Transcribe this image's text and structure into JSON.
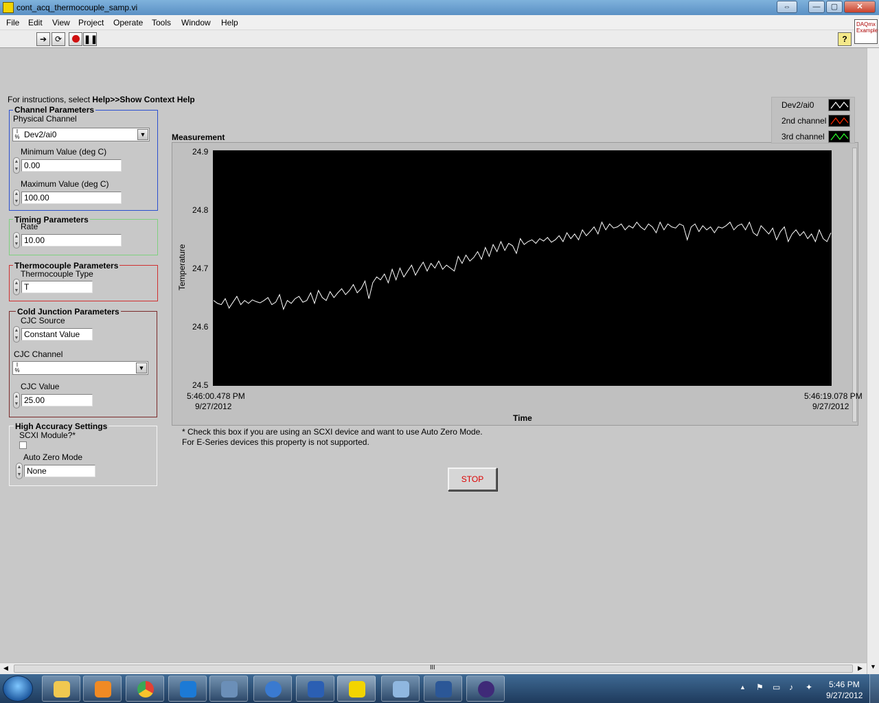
{
  "window": {
    "title": "cont_acq_thermocouple_samp.vi",
    "controls": {
      "restore": "⇔",
      "minimize": "—",
      "maximize": "▢",
      "close": "✕"
    }
  },
  "menu": [
    "File",
    "Edit",
    "View",
    "Project",
    "Operate",
    "Tools",
    "Window",
    "Help"
  ],
  "toolbar": {
    "help_button": "?",
    "daqmx_badge": "DAQmx Example"
  },
  "instructions": {
    "prefix": "For instructions, select ",
    "bold": "Help>>Show Context Help"
  },
  "channel": {
    "group_title": "Channel Parameters",
    "physical_label": "Physical Channel",
    "physical_value": "Dev2/ai0",
    "min_label": "Minimum Value (deg C)",
    "min_value": "0.00",
    "max_label": "Maximum Value (deg C)",
    "max_value": "100.00"
  },
  "timing": {
    "group_title": "Timing Parameters",
    "rate_label": "Rate",
    "rate_value": "10.00"
  },
  "thermocouple": {
    "group_title": "Thermocouple Parameters",
    "type_label": "Thermocouple Type",
    "type_value": "T"
  },
  "cold_junction": {
    "group_title": "Cold Junction Parameters",
    "source_label": "CJC Source",
    "source_value": "Constant Value",
    "channel_label": "CJC Channel",
    "channel_value": "",
    "value_label": "CJC Value",
    "value_value": "25.00"
  },
  "high_accuracy": {
    "group_title": "High Accuracy Settings",
    "scxi_label": "SCXI Module?*",
    "scxi_checked": false,
    "autozero_label": "Auto Zero Mode",
    "autozero_value": "None"
  },
  "footnote": {
    "line1": "* Check this box if you are using an SCXI device and want to use Auto Zero Mode.",
    "line2": "For E-Series devices this property is not supported."
  },
  "stop_button": "STOP",
  "legend": [
    {
      "name": "Dev2/ai0",
      "color": "#ffffff"
    },
    {
      "name": "2nd channel",
      "color": "#ff2a00"
    },
    {
      "name": "3rd channel",
      "color": "#2aff2a"
    }
  ],
  "chart_data": {
    "type": "line",
    "title": "Measurement",
    "xlabel": "Time",
    "ylabel": "Temperature",
    "ylim": [
      24.5,
      24.9
    ],
    "y_ticks": [
      "24.9",
      "24.8",
      "24.7",
      "24.6",
      "24.5"
    ],
    "x_start": {
      "time": "5:46:00.478 PM",
      "date": "9/27/2012"
    },
    "x_end": {
      "time": "5:46:19.078 PM",
      "date": "9/27/2012"
    },
    "grid": false,
    "legend_position": "top-right",
    "series": [
      {
        "name": "Dev2/ai0",
        "color": "#ffffff",
        "values": [
          24.645,
          24.64,
          24.638,
          24.648,
          24.632,
          24.642,
          24.652,
          24.638,
          24.645,
          24.64,
          24.646,
          24.643,
          24.641,
          24.645,
          24.65,
          24.638,
          24.642,
          24.655,
          24.63,
          24.645,
          24.64,
          24.648,
          24.652,
          24.642,
          24.645,
          24.658,
          24.64,
          24.662,
          24.65,
          24.645,
          24.66,
          24.65,
          24.658,
          24.665,
          24.655,
          24.662,
          24.672,
          24.658,
          24.665,
          24.678,
          24.648,
          24.675,
          24.685,
          24.68,
          24.69,
          24.675,
          24.698,
          24.68,
          24.7,
          24.685,
          24.695,
          24.705,
          24.688,
          24.7,
          24.71,
          24.695,
          24.708,
          24.7,
          24.712,
          24.698,
          24.705,
          24.7,
          24.695,
          24.72,
          24.708,
          24.722,
          24.712,
          24.718,
          24.728,
          24.715,
          24.735,
          24.72,
          24.74,
          24.728,
          24.745,
          24.73,
          24.742,
          24.738,
          24.725,
          24.75,
          24.74,
          24.745,
          24.748,
          24.742,
          24.75,
          24.746,
          24.752,
          24.744,
          24.748,
          24.755,
          24.745,
          24.76,
          24.75,
          24.758,
          24.748,
          24.765,
          24.755,
          24.762,
          24.77,
          24.758,
          24.778,
          24.765,
          24.775,
          24.768,
          24.77,
          24.775,
          24.765,
          24.772,
          24.768,
          24.778,
          24.77,
          24.765,
          24.775,
          24.77,
          24.76,
          24.778,
          24.765,
          24.775,
          24.77,
          24.768,
          24.775,
          24.772,
          24.748,
          24.77,
          24.775,
          24.762,
          24.772,
          24.765,
          24.77,
          24.76,
          24.77,
          24.768,
          24.772,
          24.778,
          24.765,
          24.772,
          24.775,
          24.765,
          24.778,
          24.76,
          24.755,
          24.772,
          24.765,
          24.758,
          24.768,
          24.748,
          24.762,
          24.77,
          24.745,
          24.758,
          24.765,
          24.755,
          24.762,
          24.75,
          24.758,
          24.745,
          24.765,
          24.75,
          24.745,
          24.76
        ]
      }
    ]
  },
  "statusbar": {
    "hscroll_grip": "III"
  },
  "taskbar": {
    "apps": [
      "explorer-icon",
      "media-player-icon",
      "chrome-icon",
      "teamviewer-icon",
      "virtualbox-icon",
      "itunes-icon",
      "xming-icon",
      "labview-icon",
      "paint-icon",
      "word-icon",
      "eclipse-icon"
    ],
    "clock_time": "5:46 PM",
    "clock_date": "9/27/2012"
  }
}
